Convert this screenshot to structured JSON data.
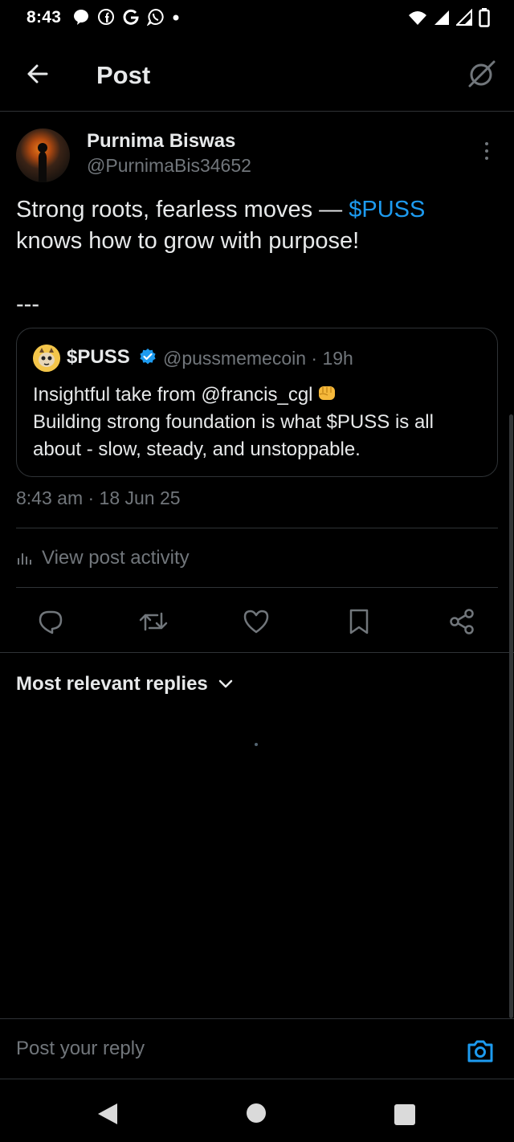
{
  "status_bar": {
    "time": "8:43",
    "left_icons": [
      "messenger-icon",
      "facebook-icon",
      "google-icon",
      "whatsapp-icon",
      "dot-icon"
    ],
    "right_icons": [
      "wifi-icon",
      "signal-icon",
      "signal-icon",
      "battery-icon"
    ]
  },
  "header": {
    "title": "Post",
    "back_icon": "arrow-left-icon",
    "grok_icon": "grok-icon"
  },
  "post": {
    "author_name": "Purnima Biswas",
    "author_handle": "@PurnimaBis34652",
    "text_part1": "Strong roots, fearless moves — ",
    "cashtag": "$PUSS",
    "text_part2": "knows how to grow with purpose!",
    "separator": "---",
    "timestamp": "8:43 am · 18 Jun 25"
  },
  "quoted_post": {
    "name": "$PUSS",
    "verified": true,
    "handle_time": "@pussmemecoin · 19h",
    "line1": "Insightful take from @francis_cgl",
    "line2": "Building strong foundation is what $PUSS is all about - slow, steady, and unstoppable."
  },
  "activity": {
    "label": "View post activity"
  },
  "actions": [
    "reply-icon",
    "repost-icon",
    "like-icon",
    "bookmark-icon",
    "share-icon"
  ],
  "replies": {
    "filter_label": "Most relevant replies"
  },
  "reply_bar": {
    "placeholder": "Post your reply"
  },
  "colors": {
    "background": "#000000",
    "text": "#e7e9ea",
    "secondary": "#71767b",
    "accent": "#1d9bf0",
    "divider": "#2f3336"
  }
}
